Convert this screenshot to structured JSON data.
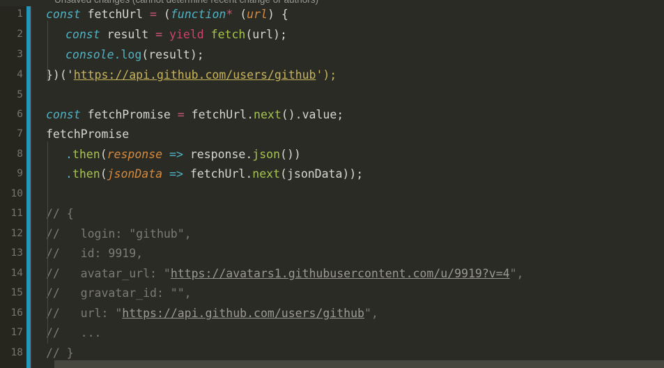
{
  "editor": {
    "notice": "Unsaved changes (cannot determine recent change or authors)",
    "background_color": "#2b2b26",
    "gutter_color": "#26261f",
    "change_bar_color": "#2496b8",
    "line_number_color": "#76766d",
    "text_color": "#d8d8cf",
    "keyword_color": "#4eb3c4",
    "operator_color": "#cc5577",
    "method_color": "#a7c44e",
    "param_color": "#d78a3c",
    "string_color": "#c8b45a",
    "comment_color": "#7c7c72",
    "yield_color": "#cc4466"
  },
  "line_numbers": [
    "1",
    "2",
    "3",
    "4",
    "5",
    "6",
    "7",
    "8",
    "9",
    "10",
    "11",
    "12",
    "13",
    "14",
    "15",
    "16",
    "17",
    "18"
  ],
  "code_lines": [
    {
      "n": "1",
      "text": "const fetchUrl = (function* (url) {"
    },
    {
      "n": "2",
      "text": "  const result = yield fetch(url);"
    },
    {
      "n": "3",
      "text": "  console.log(result);"
    },
    {
      "n": "4",
      "text": "})('https://api.github.com/users/github');"
    },
    {
      "n": "5",
      "text": ""
    },
    {
      "n": "6",
      "text": "const fetchPromise = fetchUrl.next().value;"
    },
    {
      "n": "7",
      "text": "fetchPromise"
    },
    {
      "n": "8",
      "text": "  .then(response => response.json())"
    },
    {
      "n": "9",
      "text": "  .then(jsonData => fetchUrl.next(jsonData));"
    },
    {
      "n": "10",
      "text": ""
    },
    {
      "n": "11",
      "text": "// {"
    },
    {
      "n": "12",
      "text": "//   login: \"github\","
    },
    {
      "n": "13",
      "text": "//   id: 9919,"
    },
    {
      "n": "14",
      "text": "//   avatar_url: \"https://avatars1.githubusercontent.com/u/9919?v=4\","
    },
    {
      "n": "15",
      "text": "//   gravatar_id: \"\","
    },
    {
      "n": "16",
      "text": "//   url: \"https://api.github.com/users/github\","
    },
    {
      "n": "17",
      "text": "//   ..."
    },
    {
      "n": "18",
      "text": "// }"
    }
  ],
  "tokens": {
    "l1": {
      "kw_const": "const",
      "name": "fetchUrl",
      "eq": "=",
      "open": "(",
      "kw_function": "function",
      "star": "*",
      "sp": " ",
      "open2": "(",
      "param": "url",
      "close": ")",
      "brace": "{"
    },
    "l2": {
      "kw_const": "const",
      "name": "result",
      "eq": "=",
      "kw_yield": "yield",
      "fn": "fetch",
      "args": "(url);"
    },
    "l3": {
      "obj": "console",
      "dot_method": ".log",
      "args": "(result);"
    },
    "l4": {
      "pre": "})('",
      "link": "https://api.github.com/users/github",
      "post": "');"
    },
    "l6": {
      "kw_const": "const",
      "name": "fetchPromise",
      "eq": "=",
      "obj": "fetchUrl.",
      "method": "next",
      "tail": "().value;"
    },
    "l7": {
      "name": "fetchPromise"
    },
    "l8": {
      "dot": ".",
      "method": "then",
      "open": "(",
      "param": "response",
      "arrow": "=>",
      "body": "response.",
      "method2": "json",
      "tail": "())"
    },
    "l9": {
      "dot": ".",
      "method": "then",
      "open": "(",
      "param": "jsonData",
      "arrow": "=>",
      "body": "fetchUrl.",
      "method2": "next",
      "tail": "(jsonData));"
    },
    "l11": {
      "c": "// {"
    },
    "l12": {
      "c": "//   login: \"github\","
    },
    "l13": {
      "c": "//   id: 9919,"
    },
    "l14": {
      "pre": "//   avatar_url: \"",
      "link": "https://avatars1.githubusercontent.com/u/9919?v=4",
      "post": "\","
    },
    "l15": {
      "c": "//   gravatar_id: \"\","
    },
    "l16": {
      "pre": "//   url: \"",
      "link": "https://api.github.com/users/github",
      "post": "\","
    },
    "l17": {
      "c": "//   ..."
    },
    "l18": {
      "c": "// }"
    }
  }
}
